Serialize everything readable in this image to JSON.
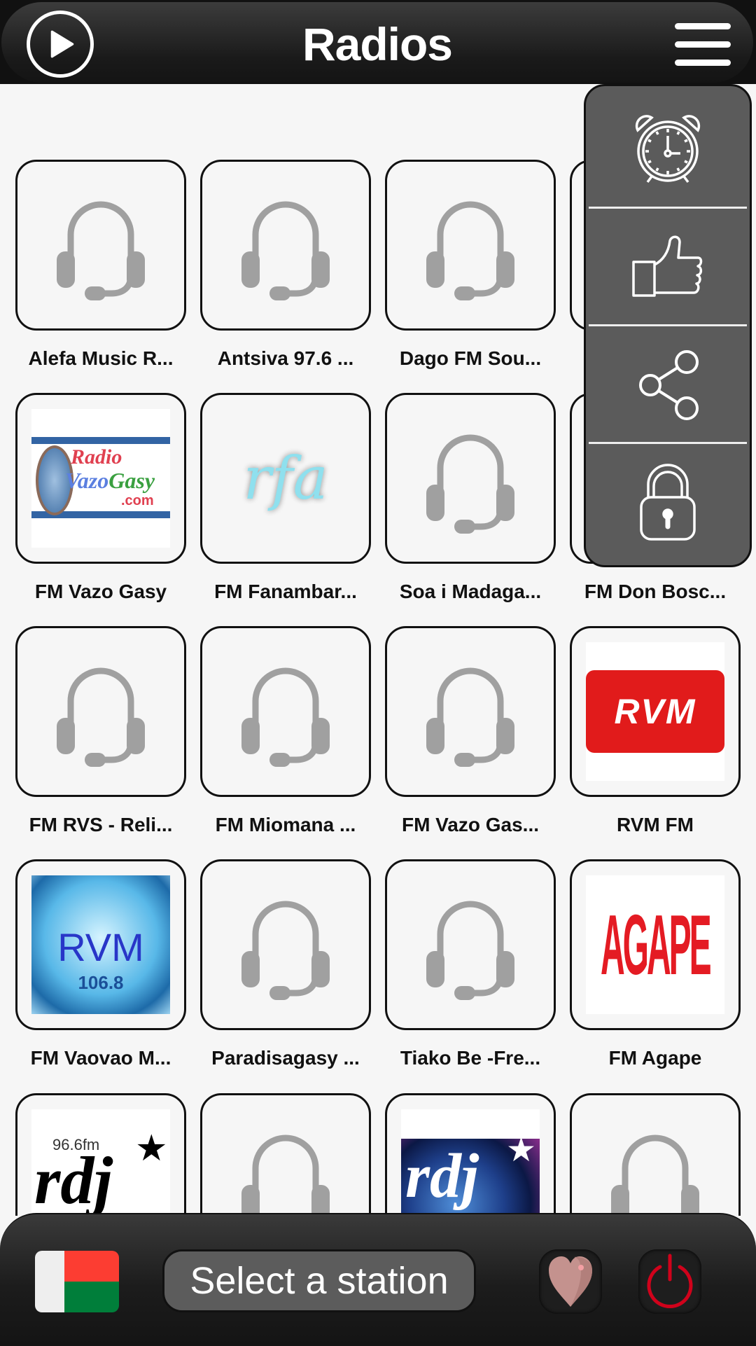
{
  "header": {
    "title": "Radios",
    "play_icon": "play-circle-icon",
    "menu_icon": "hamburger-menu-icon"
  },
  "dropdown_menu": {
    "items": [
      {
        "name": "sleep-timer",
        "icon": "alarm-clock-icon"
      },
      {
        "name": "rate-app",
        "icon": "thumbs-up-icon"
      },
      {
        "name": "share",
        "icon": "share-icon"
      },
      {
        "name": "privacy",
        "icon": "lock-icon"
      }
    ]
  },
  "stations": [
    {
      "label": "Alefa Music R...",
      "logo": "placeholder"
    },
    {
      "label": "Antsiva 97.6 ...",
      "logo": "placeholder"
    },
    {
      "label": "Dago FM Sou...",
      "logo": "placeholder"
    },
    {
      "label": "",
      "logo": "placeholder"
    },
    {
      "label": "FM Vazo Gasy",
      "logo": "vazogasy",
      "logo_text": "Radio Vazo Gasy .com"
    },
    {
      "label": "FM Fanambar...",
      "logo": "rfa",
      "logo_text": "rfa"
    },
    {
      "label": "Soa i Madaga...",
      "logo": "placeholder"
    },
    {
      "label": "FM Don Bosc...",
      "logo": "placeholder"
    },
    {
      "label": "FM RVS - Reli...",
      "logo": "placeholder"
    },
    {
      "label": "FM Miomana ...",
      "logo": "placeholder"
    },
    {
      "label": "FM Vazo Gas...",
      "logo": "placeholder"
    },
    {
      "label": "RVM FM",
      "logo": "rvm-red",
      "logo_text": "RVM"
    },
    {
      "label": "FM Vaovao M...",
      "logo": "rvm-globe",
      "logo_text": "RVM",
      "logo_subtext": "106.8"
    },
    {
      "label": "Paradisagasy ...",
      "logo": "placeholder"
    },
    {
      "label": "Tiako Be -Fre...",
      "logo": "placeholder"
    },
    {
      "label": "FM Agape",
      "logo": "agape",
      "logo_text": "AGAPE"
    },
    {
      "label": "",
      "logo": "rdj-white",
      "logo_text": "rdj",
      "logo_subtext": "96.6fm"
    },
    {
      "label": "",
      "logo": "placeholder"
    },
    {
      "label": "",
      "logo": "rdj-earth",
      "logo_text": "rdj"
    },
    {
      "label": "",
      "logo": "placeholder"
    }
  ],
  "bottom_bar": {
    "country_flag": "madagascar-flag",
    "station_button_label": "Select a station",
    "favorite_icon": "heart-icon",
    "power_icon": "power-icon"
  },
  "colors": {
    "header_bg": "#1a1a1a",
    "menu_bg": "#5b5b5b",
    "placeholder_icon": "#a0a0a0",
    "power_red": "#d0021b",
    "heart": "#c4928e",
    "flag_red": "#fc3d32",
    "flag_green": "#007e3a"
  }
}
